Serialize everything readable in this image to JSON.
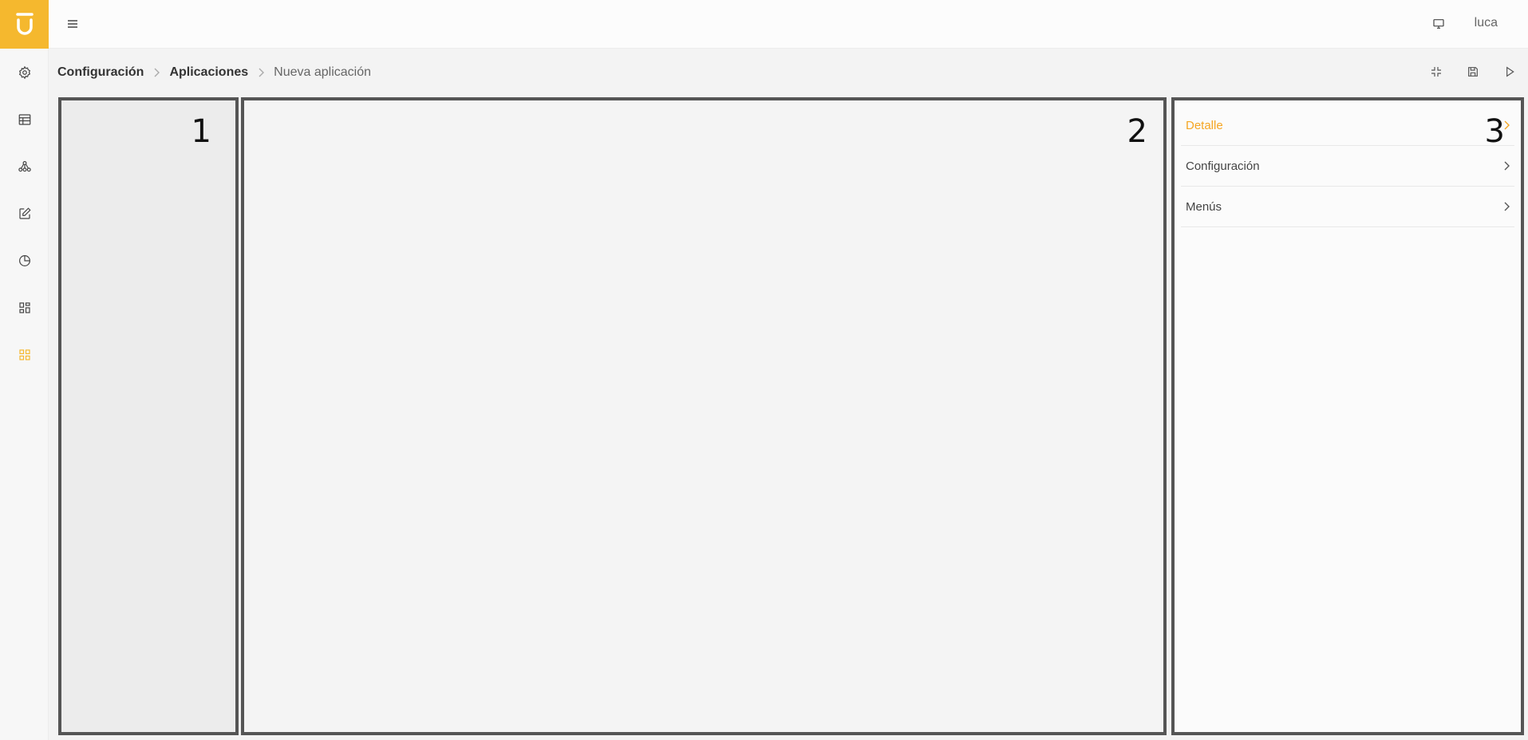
{
  "topbar": {
    "user_name": "luca"
  },
  "breadcrumb": {
    "items": [
      "Configuración",
      "Aplicaciones"
    ],
    "current": "Nueva aplicación"
  },
  "panels": {
    "left_number": "1",
    "center_number": "2",
    "right_number": "3"
  },
  "side_menu": {
    "items": [
      {
        "label": "Detalle",
        "active": true
      },
      {
        "label": "Configuración",
        "active": false
      },
      {
        "label": "Menús",
        "active": false
      }
    ]
  },
  "colors": {
    "accent": "#f5b82e",
    "active_text": "#f5a623",
    "panel_border": "#555555"
  },
  "icons": {
    "rail": [
      "gear-icon",
      "table-icon",
      "hierarchy-icon",
      "edit-icon",
      "pie-chart-icon",
      "widgets-icon",
      "grid-icon"
    ],
    "topbar": [
      "hamburger-icon",
      "monitor-icon"
    ],
    "actions": [
      "collapse-icon",
      "save-icon",
      "play-icon"
    ]
  }
}
